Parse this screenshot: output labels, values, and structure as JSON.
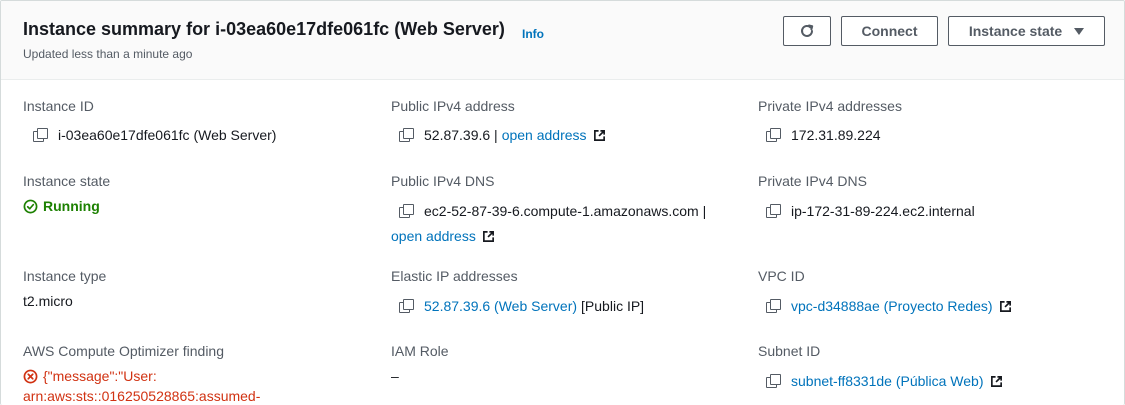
{
  "header": {
    "title": "Instance summary for i-03ea60e17dfe061fc (Web Server)",
    "info_link": "Info",
    "subtitle": "Updated less than a minute ago",
    "buttons": {
      "refresh_icon": "refresh-icon",
      "connect": "Connect",
      "instance_state": "Instance state"
    }
  },
  "details": {
    "instance_id": {
      "label": "Instance ID",
      "value": "i-03ea60e17dfe061fc (Web Server)"
    },
    "instance_state": {
      "label": "Instance state",
      "value": "Running"
    },
    "instance_type": {
      "label": "Instance type",
      "value": "t2.micro"
    },
    "optimizer": {
      "label": "AWS Compute Optimizer finding",
      "line1": "{\"message\":\"User:",
      "line2": "arn:aws:sts::016250528865:assumed-"
    },
    "public_ipv4": {
      "label": "Public IPv4 address",
      "value": "52.87.39.6 |",
      "link": "open address"
    },
    "public_dns": {
      "label": "Public IPv4 DNS",
      "value": "ec2-52-87-39-6.compute-1.amazonaws.com |",
      "link": "open address"
    },
    "elastic_ip": {
      "label": "Elastic IP addresses",
      "link": "52.87.39.6 (Web Server)",
      "suffix": "[Public IP]"
    },
    "iam_role": {
      "label": "IAM Role",
      "value": "–"
    },
    "private_ipv4": {
      "label": "Private IPv4 addresses",
      "value": "172.31.89.224"
    },
    "private_dns": {
      "label": "Private IPv4 DNS",
      "value": "ip-172-31-89-224.ec2.internal"
    },
    "vpc_id": {
      "label": "VPC ID",
      "link": "vpc-d34888ae (Proyecto Redes)"
    },
    "subnet_id": {
      "label": "Subnet ID",
      "link": "subnet-ff8331de (Pública Web)"
    }
  },
  "colors": {
    "link": "#0073bb",
    "success": "#1d8102",
    "error": "#d13212",
    "label": "#545b64"
  }
}
